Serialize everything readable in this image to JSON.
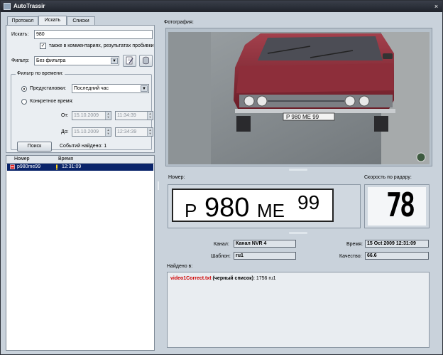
{
  "window": {
    "title": "AutoTrassir",
    "close": "×"
  },
  "tabs": [
    {
      "label": "Протокол",
      "active": false
    },
    {
      "label": "Искать",
      "active": true
    },
    {
      "label": "Списки",
      "active": false
    }
  ],
  "search": {
    "label": "Искать:",
    "value": "980",
    "also_checkbox": {
      "label": "также в комментариях, результатах пробивки",
      "checked": true
    },
    "filter_label": "Фильтр:",
    "filter_value": "Без фильтра",
    "time_group_title": "Фильтр по времени:",
    "preset_radio": {
      "label": "Предустановки:",
      "selected": true
    },
    "preset_value": "Последний час",
    "specific_radio": {
      "label": "Конкретное время:",
      "selected": false
    },
    "from_label": "От:",
    "from_date": "15.10.2009",
    "from_time": "11:34:39",
    "to_label": "До:",
    "to_date": "15.10.2009",
    "to_time": "12:34:39",
    "search_button": "Поиск",
    "events_found": "Событий найдено: 1"
  },
  "results": {
    "columns": [
      "Номер",
      "Время"
    ],
    "rows": [
      {
        "number": "p980me99",
        "time": "12:31:09",
        "status": "blacklist"
      }
    ]
  },
  "photo_section": {
    "label": "Фотография:"
  },
  "number_section": {
    "label": "Номер:",
    "plate_letter1": "P",
    "plate_digits": "980",
    "plate_letters2": "ME",
    "plate_region": "99"
  },
  "speed_section": {
    "label": "Скорость по радару:",
    "value": "78"
  },
  "details": {
    "channel_label": "Канал:",
    "channel_value": "Канал NVR 4",
    "template_label": "Шаблон:",
    "template_value": "ru1",
    "time_label": "Время:",
    "time_value": "15 Oct 2009 12:31:09",
    "quality_label": "Качество:",
    "quality_value": "66.6"
  },
  "found_in": {
    "label": "Найдено в:",
    "file": "video1Correct.txt",
    "list": "(черный список)",
    "rest": ": 1756 ru1"
  },
  "colors": {
    "titlebar": "#1f232b",
    "panel": "#c9d2db",
    "selection": "#0a246a",
    "file_link": "#d00000",
    "car": "#8c2a36"
  }
}
